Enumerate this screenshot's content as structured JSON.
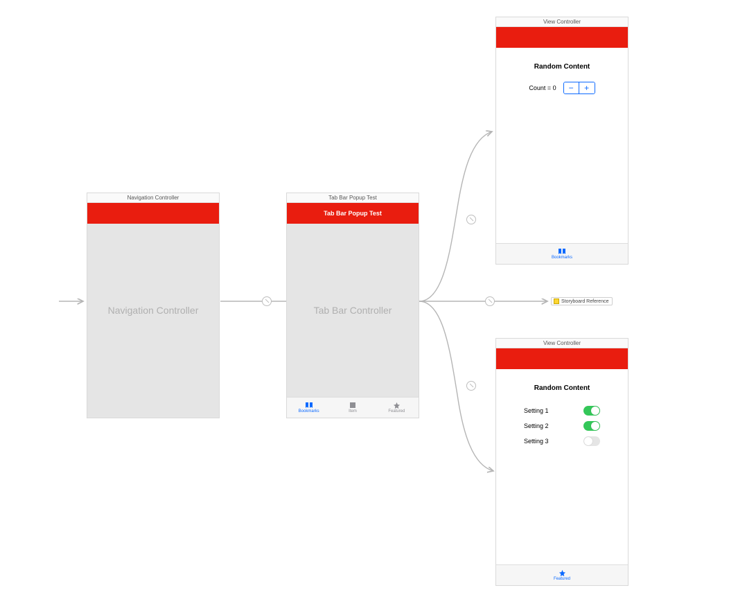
{
  "scenes": {
    "nav": {
      "title": "Navigation Controller",
      "placeholder": "Navigation Controller"
    },
    "tab": {
      "title": "Tab Bar Popup Test",
      "nav_title": "Tab Bar Popup Test",
      "placeholder": "Tab Bar Controller",
      "tabs": [
        {
          "label": "Bookmarks",
          "icon": "bookmarks-icon",
          "active": true
        },
        {
          "label": "Item",
          "icon": "square-icon",
          "active": false
        },
        {
          "label": "Featured",
          "icon": "star-icon",
          "active": false
        }
      ]
    },
    "vc1": {
      "title": "View Controller",
      "heading": "Random Content",
      "count_label": "Count = 0",
      "tab_label": "Bookmarks"
    },
    "vc2": {
      "title": "View Controller",
      "heading": "Random Content",
      "settings": [
        {
          "label": "Setting 1",
          "on": true
        },
        {
          "label": "Setting 2",
          "on": true
        },
        {
          "label": "Setting 3",
          "on": false
        }
      ],
      "tab_label": "Featured"
    }
  },
  "storyboard_ref": "Storyboard Reference",
  "colors": {
    "nav_red": "#e91d0f",
    "tint_blue": "#0b69ff",
    "switch_green": "#34c759"
  }
}
